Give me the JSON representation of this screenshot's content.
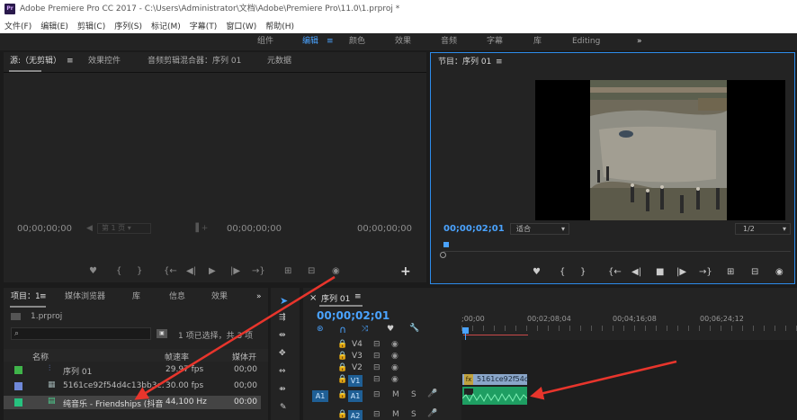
{
  "window": {
    "app_badge": "Pr",
    "title": "Adobe Premiere Pro CC 2017 - C:\\Users\\Administrator\\文档\\Adobe\\Premiere Pro\\11.0\\1.prproj *"
  },
  "menu": [
    "文件(F)",
    "编辑(E)",
    "剪辑(C)",
    "序列(S)",
    "标记(M)",
    "字幕(T)",
    "窗口(W)",
    "帮助(H)"
  ],
  "workspaces": {
    "items": [
      "组件",
      "编辑",
      "颜色",
      "效果",
      "音频",
      "字幕",
      "库",
      "Editing"
    ],
    "active": "编辑",
    "more": "»"
  },
  "source_panel": {
    "tabs": [
      "源:（无剪辑）",
      "效果控件",
      "音频剪辑混合器：序列 01",
      "元数据"
    ],
    "menu_icon": "≡",
    "timecode_left": "00;00;00;00",
    "timecode_mid": "00;00;00;00",
    "timecode_right": "00;00;00;00",
    "page_label": "第 1 页"
  },
  "program_panel": {
    "title": "节目：序列 01",
    "menu_icon": "≡",
    "timecode": "00;00;02;01",
    "fit": "适合",
    "resolution": "1/2"
  },
  "project_panel": {
    "tabs": [
      "项目：1",
      "媒体浏览器",
      "库",
      "信息",
      "效果"
    ],
    "more": "»",
    "file": "1.prproj",
    "search_placeholder": "",
    "selection_info": "1 项已选择，共 3 项",
    "columns": [
      "名称",
      "帧速率",
      "媒体开"
    ],
    "items": [
      {
        "name": "序列 01",
        "rate": "29.97 fps",
        "start": "00;00",
        "color": "#3fb44a"
      },
      {
        "name": "5161ce92f54d4c13bb3c1f",
        "rate": "30.00 fps",
        "start": "00;00",
        "color": "#6f88d8"
      },
      {
        "name": "纯音乐 - Friendships (抖音",
        "rate": "44,100 Hz",
        "start": "00:00",
        "color": "#27c27f"
      }
    ]
  },
  "timeline_panel": {
    "title": "序列 01",
    "menu_icon": "≡",
    "timecode": "00;00;02;01",
    "ruler": [
      ";00;00",
      "00;02;08;04",
      "00;04;16;08",
      "00;06;24;12"
    ],
    "tracks": [
      {
        "label": "V4"
      },
      {
        "label": "V3"
      },
      {
        "label": "V2"
      },
      {
        "label": "V1"
      },
      {
        "label": "A1",
        "src": "A1"
      },
      {
        "label": "A2"
      }
    ],
    "track_btn_m": "M",
    "track_btn_s": "S",
    "video_clip": "5161ce92f54d",
    "video_clip_fx": "fx"
  }
}
